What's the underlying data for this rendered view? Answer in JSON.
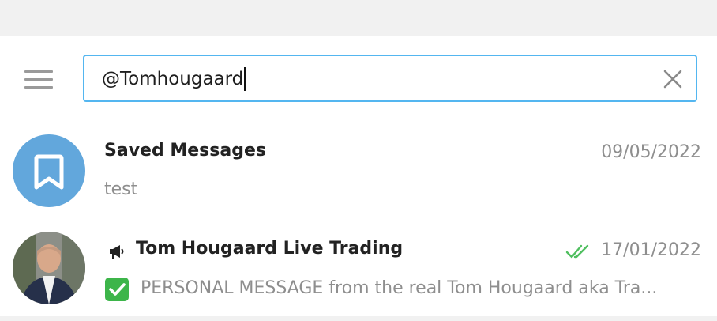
{
  "search": {
    "value": "@Tomhougaard"
  },
  "icons": {
    "menu": "hamburger-menu-icon",
    "clear": "close-icon",
    "saved": "bookmark-icon",
    "channel": "megaphone-icon",
    "read": "double-check-icon",
    "emoji": "green-check-emoji-icon"
  },
  "colors": {
    "search_border": "#54b6f0",
    "saved_avatar_bg": "#62a7dc",
    "read_check": "#4fbf5f",
    "emoji_bg": "#3db54a"
  },
  "chats": [
    {
      "name": "Saved Messages",
      "date": "09/05/2022",
      "preview": "test"
    },
    {
      "name": "Tom Hougaard Live Trading",
      "date": "17/01/2022",
      "preview": "PERSONAL MESSAGE from the real Tom Hougaard aka Tra..."
    }
  ]
}
